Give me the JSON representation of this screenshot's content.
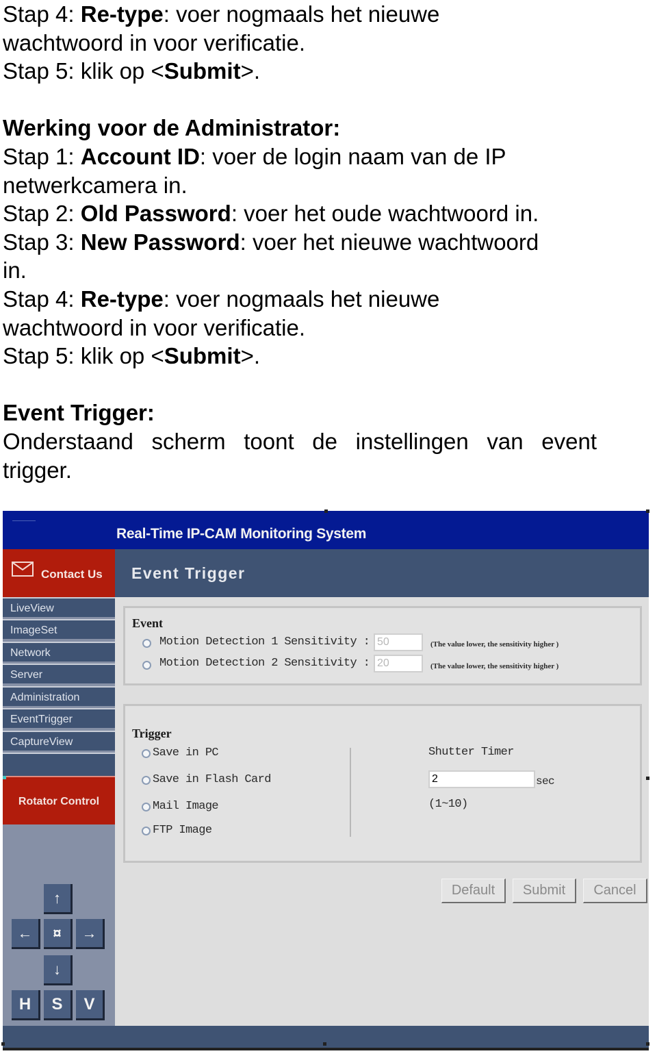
{
  "document": {
    "block1": [
      {
        "prefix": "Stap 4: ",
        "bold": "Re-type",
        "suffix": ": voer nogmaals het nieuwe"
      },
      {
        "text": "wachtwoord in voor verificatie."
      },
      {
        "prefix": "Stap 5: klik op <",
        "bold": "Submit",
        "suffix": ">."
      }
    ],
    "admin_heading": "Werking voor de Administrator:",
    "admin_steps": [
      {
        "prefix": "Stap 1: ",
        "bold": "Account ID",
        "suffix": ": voer de login naam van de IP"
      },
      {
        "text": "netwerkcamera in."
      },
      {
        "prefix": "Stap 2: ",
        "bold": "Old Password",
        "suffix": ": voer het oude wachtwoord in."
      },
      {
        "prefix": "Stap 3: ",
        "bold": "New Password",
        "suffix": ": voer het nieuwe wachtwoord"
      },
      {
        "text": "in."
      },
      {
        "prefix": "Stap 4: ",
        "bold": "Re-type",
        "suffix": ": voer nogmaals het nieuwe"
      },
      {
        "text": "wachtwoord in voor verificatie."
      },
      {
        "prefix": "Stap 5: klik op <",
        "bold": "Submit",
        "suffix": ">."
      }
    ],
    "event_heading": "Event Trigger:",
    "event_description": "Onderstaand scherm toont de instellingen van event trigger."
  },
  "camera_ui": {
    "app_title": "Real-Time IP-CAM Monitoring System",
    "contact": {
      "label": "Contact Us",
      "icon": "envelope-icon"
    },
    "page_title": "Event Trigger",
    "colors": {
      "topbar": "#041a93",
      "nav": "#3f5373",
      "accent_red": "#b11c0c",
      "content_bg": "#dedede"
    },
    "sidebar": {
      "items": [
        {
          "label": "LiveView"
        },
        {
          "label": "ImageSet"
        },
        {
          "label": "Network"
        },
        {
          "label": "Server"
        },
        {
          "label": "Administration"
        },
        {
          "label": "EventTrigger"
        },
        {
          "label": "CaptureView"
        },
        {
          "label": ""
        }
      ],
      "rotator_label": "Rotator Control",
      "ptz": {
        "up": "↑",
        "left": "←",
        "center": "¤",
        "right": "→",
        "down": "↓",
        "h": "H",
        "s": "S",
        "v": "V"
      }
    },
    "event_panel": {
      "title": "Event",
      "options": [
        {
          "label": "Motion Detection 1 Sensitivity :",
          "value": "50",
          "hint": "(The value lower, the sensitivity higher )",
          "selected": false
        },
        {
          "label": "Motion Detection 2 Sensitivity :",
          "value": "20",
          "hint": "(The value lower, the sensitivity higher )",
          "selected": false
        }
      ]
    },
    "trigger_panel": {
      "title": "Trigger",
      "options": [
        {
          "label": "Save in PC",
          "selected": false
        },
        {
          "label": "Save in Flash Card",
          "selected": false
        },
        {
          "label": "Mail Image",
          "selected": false
        },
        {
          "label": "FTP Image",
          "selected": false
        }
      ],
      "shutter_timer": {
        "label": "Shutter Timer",
        "value": "2",
        "unit": "sec",
        "range": "(1~10)"
      }
    },
    "buttons": {
      "default": "Default",
      "submit": "Submit",
      "cancel": "Cancel"
    }
  }
}
